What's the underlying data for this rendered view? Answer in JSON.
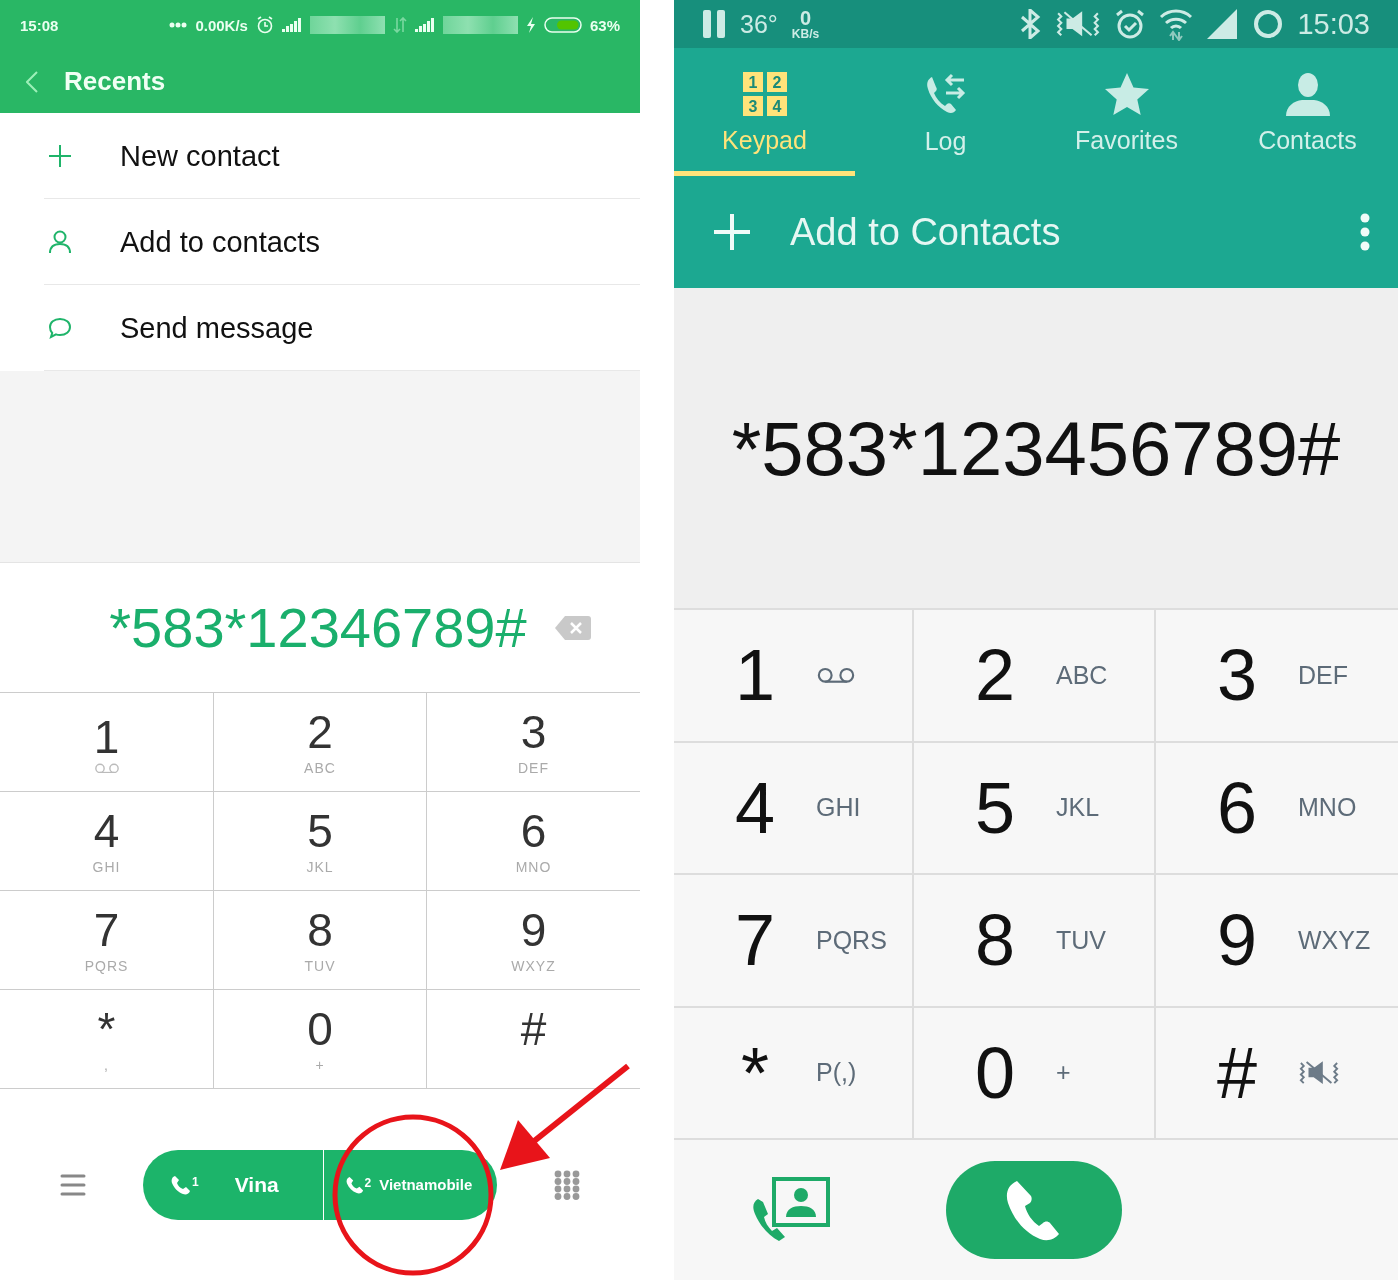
{
  "left_phone": {
    "status_bar": {
      "time": "15:08",
      "net_speed": "0.00K/s",
      "battery": "63%"
    },
    "header": {
      "title": "Recents"
    },
    "menu": [
      {
        "kind": "add",
        "label": "New contact"
      },
      {
        "kind": "person",
        "label": "Add to contacts"
      },
      {
        "kind": "message",
        "label": "Send message"
      }
    ],
    "dialed_number": "*583*12346789#",
    "keypad": [
      {
        "digit": "1",
        "kind": "voicemail"
      },
      {
        "digit": "2",
        "kind": "letters",
        "letters": "ABC"
      },
      {
        "digit": "3",
        "kind": "letters",
        "letters": "DEF"
      },
      {
        "digit": "4",
        "kind": "letters",
        "letters": "GHI"
      },
      {
        "digit": "5",
        "kind": "letters",
        "letters": "JKL"
      },
      {
        "digit": "6",
        "kind": "letters",
        "letters": "MNO"
      },
      {
        "digit": "7",
        "kind": "letters",
        "letters": "PQRS"
      },
      {
        "digit": "8",
        "kind": "letters",
        "letters": "TUV"
      },
      {
        "digit": "9",
        "kind": "letters",
        "letters": "WXYZ"
      },
      {
        "digit": "*",
        "kind": "letters",
        "letters": ","
      },
      {
        "digit": "0",
        "kind": "letters",
        "letters": "+"
      },
      {
        "digit": "#",
        "kind": "plain"
      }
    ],
    "call_buttons": [
      {
        "sim": "1",
        "label": "Vina"
      },
      {
        "sim": "2",
        "label": "Vietnamobile"
      }
    ]
  },
  "right_phone": {
    "status_bar": {
      "temperature": "36°",
      "speed_value": "0",
      "speed_unit": "KB/s",
      "time": "15:03"
    },
    "tabs": [
      {
        "kind": "keypad",
        "label": "Keypad",
        "selected": true,
        "icon_digits": [
          "1",
          "2",
          "3",
          "4"
        ]
      },
      {
        "kind": "log",
        "label": "Log",
        "selected": false
      },
      {
        "kind": "favorites",
        "label": "Favorites",
        "selected": false
      },
      {
        "kind": "contacts",
        "label": "Contacts",
        "selected": false
      }
    ],
    "action_bar": {
      "label": "Add to Contacts"
    },
    "dialed_number": "*583*123456789#",
    "keypad": [
      {
        "digit": "1",
        "kind": "voicemail"
      },
      {
        "digit": "2",
        "kind": "letters",
        "letters": "ABC"
      },
      {
        "digit": "3",
        "kind": "letters",
        "letters": "DEF"
      },
      {
        "digit": "4",
        "kind": "letters",
        "letters": "GHI"
      },
      {
        "digit": "5",
        "kind": "letters",
        "letters": "JKL"
      },
      {
        "digit": "6",
        "kind": "letters",
        "letters": "MNO"
      },
      {
        "digit": "7",
        "kind": "letters",
        "letters": "PQRS"
      },
      {
        "digit": "8",
        "kind": "letters",
        "letters": "TUV"
      },
      {
        "digit": "9",
        "kind": "letters",
        "letters": "WXYZ"
      },
      {
        "digit": "*",
        "kind": "letters",
        "letters": "P(,)"
      },
      {
        "digit": "0",
        "kind": "letters",
        "letters": "+"
      },
      {
        "digit": "#",
        "kind": "vibrate"
      }
    ]
  }
}
